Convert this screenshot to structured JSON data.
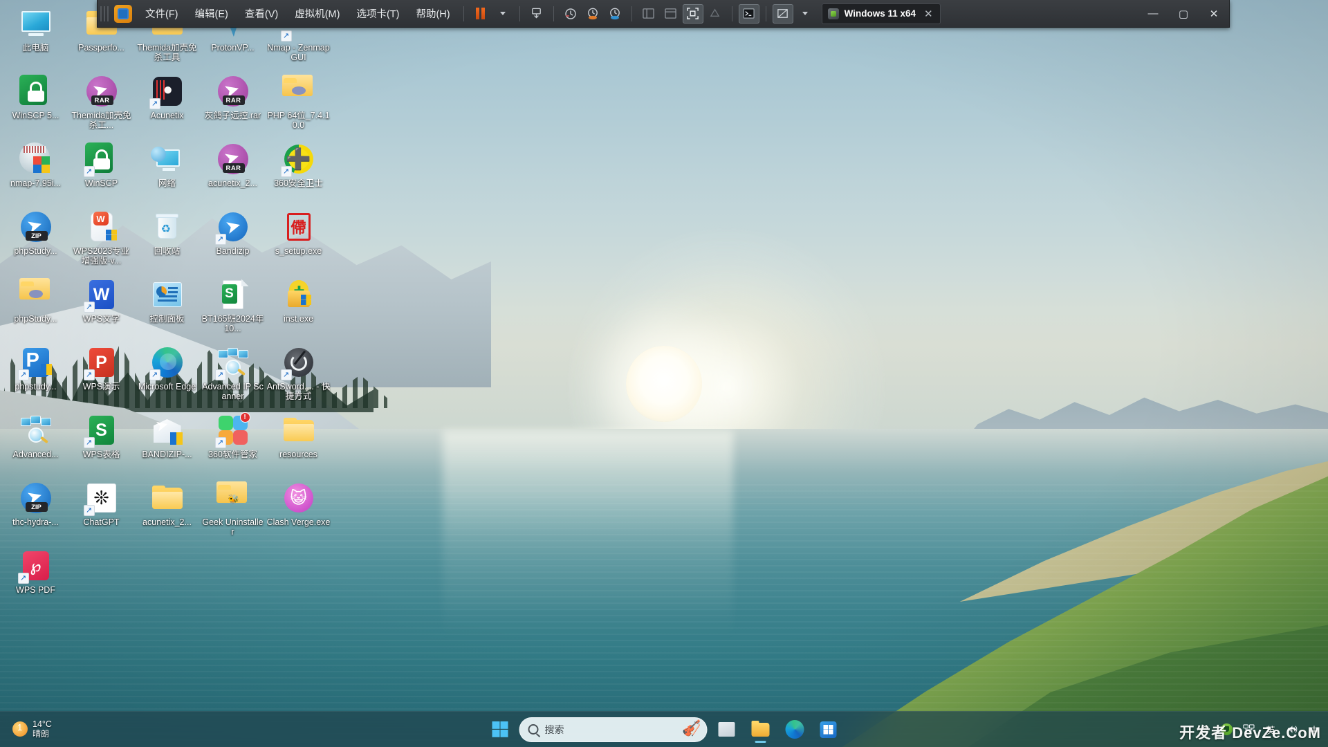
{
  "vmware": {
    "app_icon": "vmware-logo-icon",
    "menus": [
      {
        "label": "文件(F)",
        "name": "menu-file"
      },
      {
        "label": "编辑(E)",
        "name": "menu-edit"
      },
      {
        "label": "查看(V)",
        "name": "menu-view"
      },
      {
        "label": "虚拟机(M)",
        "name": "menu-vm"
      },
      {
        "label": "选项卡(T)",
        "name": "menu-tabs"
      },
      {
        "label": "帮助(H)",
        "name": "menu-help"
      }
    ],
    "toolbar": {
      "suspend": "pause-icon",
      "power_dropdown": "chevron-down-icon",
      "snapshot": "snapshot-icon",
      "snapshot_manager": "snapshot-manager-icon",
      "revert_snapshot": "revert-snapshot-icon",
      "take_snapshot": "take-snapshot-icon",
      "show_library": "show-library-icon",
      "show_thumbnails": "show-thumbnail-bar-icon",
      "fullscreen": "fullscreen-icon",
      "unity": "unity-mode-icon",
      "console": "console-icon",
      "stretch": "stretch-guest-icon",
      "stretch_dropdown": "chevron-down-icon"
    },
    "tab": {
      "title": "Windows 11 x64",
      "icon": "vm-tab-icon",
      "close": "✕"
    },
    "window_buttons": {
      "minimize": "—",
      "maximize": "▢",
      "close": "✕"
    }
  },
  "desktop": {
    "icons": [
      {
        "label": "此电脑",
        "art": "i-pc",
        "shortcut": false,
        "badge": null
      },
      {
        "label": "Passperfo...",
        "art": "i-folder",
        "shortcut": false,
        "badge": null
      },
      {
        "label": "Themida加壳免杀工具",
        "art": "i-folder",
        "shortcut": false,
        "badge": null
      },
      {
        "label": "ProtonVP...",
        "art": "i-protonvpn",
        "shortcut": false,
        "badge": null
      },
      {
        "label": "Nmap - Zenmap GUI",
        "art": "i-nmapshort",
        "shortcut": true,
        "badge": null
      },
      {
        "label": "WinSCP 5...",
        "art": "i-winscp",
        "shortcut": false,
        "badge": null
      },
      {
        "label": "Themida加壳免杀工...",
        "art": "i-rar",
        "shortcut": false,
        "badge": null
      },
      {
        "label": "Acunetix",
        "art": "i-acunetix",
        "shortcut": true,
        "badge": null
      },
      {
        "label": "灰鸽子远控.rar",
        "art": "i-rar",
        "shortcut": false,
        "badge": null
      },
      {
        "label": "PHP 64位_7.4.10.0",
        "art": "i-php",
        "shortcut": false,
        "badge": null
      },
      {
        "label": "nmap-7.95i...",
        "art": "i-nmap",
        "shortcut": false,
        "badge": null
      },
      {
        "label": "WinSCP",
        "art": "i-winscp",
        "shortcut": true,
        "badge": null
      },
      {
        "label": "网络",
        "art": "i-net",
        "shortcut": false,
        "badge": null
      },
      {
        "label": "acunetix_2...",
        "art": "i-rar",
        "shortcut": false,
        "badge": null
      },
      {
        "label": "360安全卫士",
        "art": "i-360",
        "shortcut": true,
        "badge": null
      },
      {
        "label": "phpStudy...",
        "art": "i-zip",
        "shortcut": false,
        "badge": null
      },
      {
        "label": "WPS2023专业增强版-v...",
        "art": "i-wps2023",
        "shortcut": false,
        "badge": null
      },
      {
        "label": "回收站",
        "art": "i-bin",
        "shortcut": false,
        "badge": null
      },
      {
        "label": "Bandizip",
        "art": "i-bandizip",
        "shortcut": true,
        "badge": null
      },
      {
        "label": "s_setup.exe",
        "art": "i-seal",
        "shortcut": false,
        "badge": null
      },
      {
        "label": "phpStudy...",
        "art": "i-php",
        "shortcut": false,
        "badge": null
      },
      {
        "label": "WPS文字",
        "art": "i-wps-w",
        "shortcut": true,
        "badge": null
      },
      {
        "label": "控制面板",
        "art": "i-ctrlpanel",
        "shortcut": false,
        "badge": null
      },
      {
        "label": "BT165班2024年10...",
        "art": "i-doc",
        "shortcut": false,
        "badge": null
      },
      {
        "label": "inst.exe",
        "art": "i-inst",
        "shortcut": false,
        "badge": null
      },
      {
        "label": "phpstudy...",
        "art": "i-phpstudy",
        "shortcut": true,
        "badge": null
      },
      {
        "label": "WPS演示",
        "art": "i-wps-p",
        "shortcut": true,
        "badge": null
      },
      {
        "label": "Microsoft Edge",
        "art": "i-edge",
        "shortcut": true,
        "badge": null
      },
      {
        "label": "Advanced IP Scanner",
        "art": "i-aipscan",
        "shortcut": true,
        "badge": null
      },
      {
        "label": "AntSword.... - 快捷方式",
        "art": "i-antsword",
        "shortcut": true,
        "badge": null
      },
      {
        "label": "Advanced...",
        "art": "i-aipscan",
        "shortcut": false,
        "badge": null
      },
      {
        "label": "WPS表格",
        "art": "i-wps-s",
        "shortcut": true,
        "badge": null
      },
      {
        "label": "BANDIZIP-...",
        "art": "i-bandizipbox",
        "shortcut": false,
        "badge": null
      },
      {
        "label": "360软件管家",
        "art": "i-360sm",
        "shortcut": true,
        "badge": "!"
      },
      {
        "label": "resources",
        "art": "i-folder",
        "shortcut": false,
        "badge": null
      },
      {
        "label": "thc-hydra-...",
        "art": "i-zip",
        "shortcut": false,
        "badge": null
      },
      {
        "label": "ChatGPT",
        "art": "i-chatgpt",
        "shortcut": true,
        "badge": null
      },
      {
        "label": "acunetix_2...",
        "art": "i-folder",
        "shortcut": false,
        "badge": null
      },
      {
        "label": "Geek Uninstaller",
        "art": "i-geek",
        "shortcut": false,
        "badge": null
      },
      {
        "label": "Clash Verge.exe",
        "art": "i-clash",
        "shortcut": false,
        "badge": null
      },
      {
        "label": "WPS PDF",
        "art": "i-wpspdf",
        "shortcut": true,
        "badge": null
      }
    ]
  },
  "taskbar": {
    "weather": {
      "temp": "14°C",
      "condition": "晴朗",
      "icon": "sun-icon"
    },
    "start": {
      "name": "start-button",
      "icon": "windows-logo-icon"
    },
    "search": {
      "placeholder": "搜索",
      "icon": "search-icon",
      "decoration": "violin-icon"
    },
    "pinned": [
      {
        "name": "taskbar-file-manager",
        "icon": "window-icon",
        "running": false
      },
      {
        "name": "taskbar-file-explorer",
        "icon": "folder-icon",
        "running": true
      },
      {
        "name": "taskbar-edge",
        "icon": "edge-icon",
        "running": false
      },
      {
        "name": "taskbar-store",
        "icon": "microsoft-store-icon",
        "running": false
      }
    ],
    "tray": {
      "chevron": "⌃",
      "security": "shield-icon",
      "network": "🖧",
      "ime": "英",
      "volume": "🔊",
      "input_mode": "中"
    }
  },
  "watermark": "开发者 DevZe.CoM"
}
